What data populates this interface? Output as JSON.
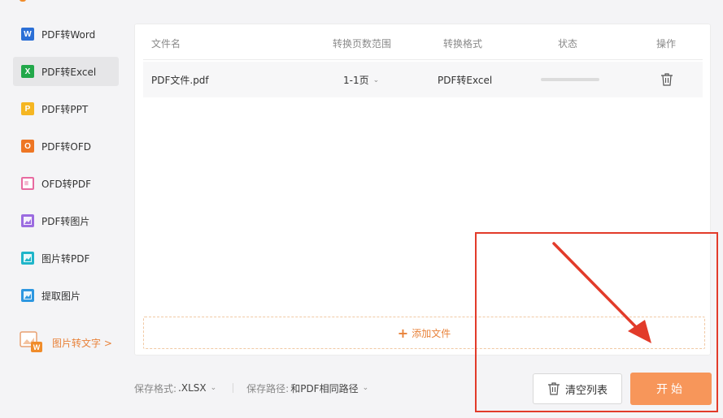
{
  "sidebar": {
    "items": [
      {
        "label": "PDF转Word",
        "icon": "word-icon",
        "icon_text": "W",
        "color": "#2b6fd6"
      },
      {
        "label": "PDF转Excel",
        "icon": "excel-icon",
        "icon_text": "X",
        "color": "#22a84a",
        "active": true
      },
      {
        "label": "PDF转PPT",
        "icon": "ppt-icon",
        "icon_text": "P",
        "color": "#f5b622"
      },
      {
        "label": "PDF转OFD",
        "icon": "ofd-icon",
        "icon_text": "O",
        "color": "#ee7624"
      },
      {
        "label": "OFD转PDF",
        "icon": "ofd-to-pdf-icon",
        "icon_text": "",
        "color": "#e86aa0"
      },
      {
        "label": "PDF转图片",
        "icon": "pdf-to-image-icon",
        "icon_text": "",
        "color": "#9b6be0"
      },
      {
        "label": "图片转PDF",
        "icon": "image-to-pdf-icon",
        "icon_text": "",
        "color": "#1fb5c9"
      },
      {
        "label": "提取图片",
        "icon": "extract-image-icon",
        "icon_text": "",
        "color": "#2d97e0"
      }
    ],
    "promo_label": "图片转文字 >"
  },
  "table": {
    "headers": {
      "filename": "文件名",
      "range": "转换页数范围",
      "format": "转换格式",
      "status": "状态",
      "action": "操作"
    },
    "rows": [
      {
        "filename": "PDF文件.pdf",
        "range": "1-1页",
        "format": "PDF转Excel",
        "progress": 0
      }
    ]
  },
  "add_file_label": "添加文件",
  "footer": {
    "format_label": "保存格式:",
    "format_value": ".XLSX",
    "path_label": "保存路径:",
    "path_value": "和PDF相同路径"
  },
  "buttons": {
    "clear": "清空列表",
    "start": "开始"
  },
  "colors": {
    "accent": "#f7965a",
    "annotation": "#e23b2a"
  }
}
